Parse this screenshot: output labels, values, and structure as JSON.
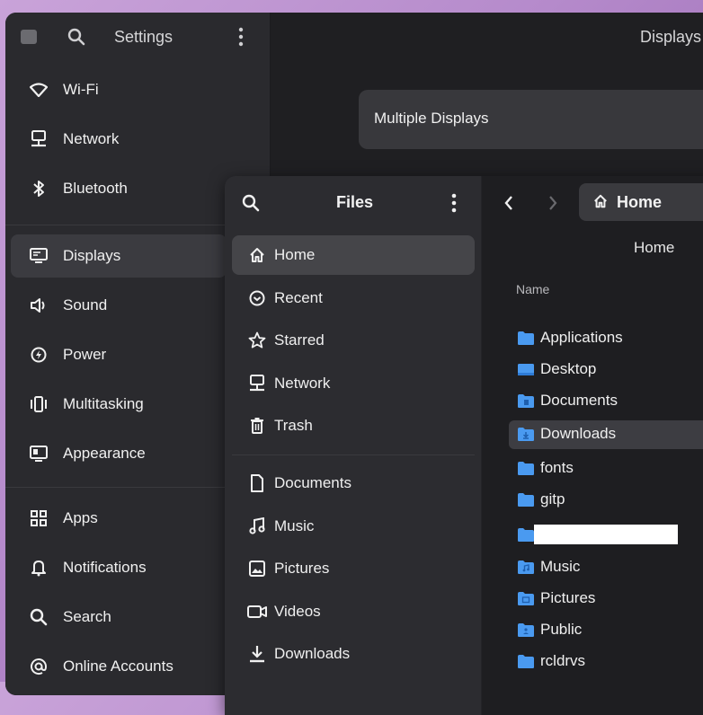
{
  "settings": {
    "title": "Settings",
    "main_title": "Displays",
    "card_label": "Multiple Displays",
    "items": [
      {
        "label": "Wi-Fi",
        "icon": "wifi-icon"
      },
      {
        "label": "Network",
        "icon": "network-icon"
      },
      {
        "label": "Bluetooth",
        "icon": "bluetooth-icon"
      },
      {
        "label": "Displays",
        "icon": "display-icon",
        "active": true
      },
      {
        "label": "Sound",
        "icon": "sound-icon"
      },
      {
        "label": "Power",
        "icon": "power-icon"
      },
      {
        "label": "Multitasking",
        "icon": "multitasking-icon"
      },
      {
        "label": "Appearance",
        "icon": "appearance-icon"
      },
      {
        "label": "Apps",
        "icon": "apps-icon"
      },
      {
        "label": "Notifications",
        "icon": "bell-icon"
      },
      {
        "label": "Search",
        "icon": "search-icon"
      },
      {
        "label": "Online Accounts",
        "icon": "at-icon"
      }
    ]
  },
  "files": {
    "title": "Files",
    "path_label": "Home",
    "location_label": "Home",
    "column_name": "Name",
    "sidebar": [
      {
        "label": "Home",
        "icon": "home-icon",
        "active": true
      },
      {
        "label": "Recent",
        "icon": "recent-icon"
      },
      {
        "label": "Starred",
        "icon": "star-icon"
      },
      {
        "label": "Network",
        "icon": "network-icon"
      },
      {
        "label": "Trash",
        "icon": "trash-icon"
      },
      {
        "label": "Documents",
        "icon": "document-icon"
      },
      {
        "label": "Music",
        "icon": "music-icon"
      },
      {
        "label": "Pictures",
        "icon": "picture-icon"
      },
      {
        "label": "Videos",
        "icon": "video-icon"
      },
      {
        "label": "Downloads",
        "icon": "download-icon"
      }
    ],
    "entries": [
      {
        "name": "Applications"
      },
      {
        "name": "Desktop"
      },
      {
        "name": "Documents"
      },
      {
        "name": "Downloads",
        "active": true
      },
      {
        "name": "fonts"
      },
      {
        "name": "gitp"
      },
      {
        "name": "",
        "redacted": true
      },
      {
        "name": "Music"
      },
      {
        "name": "Pictures"
      },
      {
        "name": "Public"
      },
      {
        "name": "rcldrvs"
      }
    ]
  },
  "colors": {
    "accent": "#3584e4",
    "folder": "#4a9af0",
    "selection": "#3d3d42"
  }
}
